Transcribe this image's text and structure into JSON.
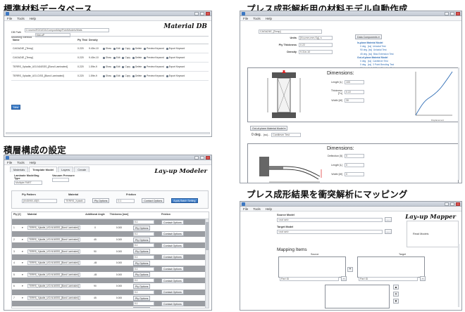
{
  "captions": {
    "db": "標準材料データベース",
    "model": "プレス成形解析用の材料モデル自動作成",
    "layup": "積層構成の設定",
    "mapping": "プレス成形結果を衝突解析にマッピング"
  },
  "material_db": {
    "menu": [
      "File",
      "Tools",
      "Help"
    ],
    "db_path_label": "DB Path",
    "db_path_value": "C:/users/ROOATA/ComposMap/PointModels/Mats",
    "method_label": "Modeling Method",
    "method_value": "Mat-aP",
    "logo": "Material DB",
    "columns": [
      "Name",
      "Ply Thickness",
      "Density"
    ],
    "rows": [
      {
        "name": "CAGAZ4E_[Temp]",
        "thickness": "0.220",
        "density": "9.40e-10"
      },
      {
        "name": "CAGAZ4E_[Temp]",
        "thickness": "0.220",
        "density": "9.40e-10"
      },
      {
        "name": "TERRS_Xpladte_UGI-N16SSS_[Bond Laminated]",
        "thickness": "0.220",
        "density": "1.59e-9"
      },
      {
        "name": "TERRS_Xpladte_UGI-CISS_[Bond Laminated]",
        "thickness": "0.220",
        "density": "1.59e-9"
      }
    ],
    "actions": [
      "Show",
      "Edit",
      "Copy",
      "Delete",
      "Preview Keyword",
      "Export Keyword"
    ],
    "new_button": "New"
  },
  "material_model": {
    "combo": "CAGAZ4E_[Temp]",
    "fields": [
      {
        "label": "Units",
        "value": "[N,s,mm,mm,Sg], s"
      },
      {
        "label": "Ply Thickness",
        "value": "0.22"
      },
      {
        "label": "Density",
        "value": "9.31e-10"
      }
    ],
    "data_components_button": "Data Components ▾",
    "tests": [
      {
        "header": true,
        "text": "In-plane Material Model"
      },
      {
        "text": "0 deg.  [ss]  Uniaxial Test"
      },
      {
        "text": "90 deg. [ss]  Uniaxial Test"
      },
      {
        "text": "45 deg. [ss]  Bias Extension Test"
      },
      {
        "header": true,
        "text": "Out-of-plane Material Model"
      },
      {
        "text": "0 deg.  [ss]  Cantilever Test"
      },
      {
        "text": "0 deg.  [ss]  3 Point Bending Test"
      },
      {
        "text": "90 deg. [ss]  3 Point Bending Test"
      }
    ],
    "dims_title": "Dimensions:",
    "dims1": [
      {
        "label": "Length [L]",
        "value": "100"
      },
      {
        "label": "Thickness [Tn]",
        "value": "0.22"
      },
      {
        "label": "Width [W]",
        "value": "30"
      }
    ],
    "dims2": [
      {
        "label": "Deflection [5]",
        "value": "0"
      },
      {
        "label": "Length [L]",
        "value": "0"
      },
      {
        "label": "Width [W]",
        "value": "0"
      }
    ],
    "out_of_plane_select": "Out-of-plane Material Model ▾",
    "deg_label": "0 deg.",
    "deg_unit": "[ss] -",
    "deg_combo": "Cantilever Test",
    "curve_xlabel": "Displacement"
  },
  "layup": {
    "menu": [
      "File",
      "Tools",
      "Help"
    ],
    "tabs": [
      "Materials",
      "Template Model",
      "Layers",
      "Create"
    ],
    "logo": "Lay-up Modeler",
    "lam_method_label": "Laminate Modelling Type",
    "lam_method_value": "Multiple PART",
    "vacuum_label": "Vacuum Pressure",
    "ply_pattern_label": "Ply Pattern",
    "ply_pattern_value": "[0/45/90/-45]S",
    "material_label": "Material",
    "material_value": "TERRS_Xpladt...",
    "ply_options_btn": "Ply Options",
    "friction_label": "Friction",
    "friction_value": "0.1",
    "contact_options_btn": "Contact Options",
    "apply_btn": "Apply Batch Setting",
    "grid_headers": [
      "Ply [#]",
      "Material",
      "Additional Angle",
      "Thickness [mm]",
      "",
      "Friction"
    ],
    "grid_rows": [
      {
        "type": "b",
        "friction": "0.1",
        "contact": "Contact Options"
      },
      {
        "type": "a",
        "ply": "1",
        "material": "TERRS_Xpladte_UGI-N16SSS_[Bond Laminated]",
        "angle": "0",
        "thickness": "0.000",
        "opt": "Ply Options"
      },
      {
        "type": "b",
        "friction": "0.1",
        "contact": "Contact Options"
      },
      {
        "type": "a",
        "ply": "2",
        "material": "TERRS_Xpladte_UGI-N16SSS_[Bond Laminated]",
        "angle": "45",
        "thickness": "0.000",
        "opt": "Ply Options"
      },
      {
        "type": "b",
        "friction": "0.1",
        "contact": "Contact Options"
      },
      {
        "type": "a",
        "ply": "3",
        "material": "TERRS_Xpladte_UGI-N16SSS_[Bond Laminated]",
        "angle": "90",
        "thickness": "0.000",
        "opt": "Ply Options"
      },
      {
        "type": "b",
        "friction": "0.1",
        "contact": "Contact Options"
      },
      {
        "type": "a",
        "ply": "4",
        "material": "TERRS_Xpladte_UGI-N16SSS_[Bond Laminated]",
        "angle": "-45",
        "thickness": "0.000",
        "opt": "Ply Options"
      },
      {
        "type": "b",
        "friction": "0.1",
        "contact": "Contact Options"
      },
      {
        "type": "a",
        "ply": "5",
        "material": "TERRS_Xpladte_UGI-N16SSS_[Bond Laminated]",
        "angle": "-45",
        "thickness": "0.000",
        "opt": "Ply Options"
      },
      {
        "type": "b",
        "friction": "0.1",
        "contact": "Contact Options"
      },
      {
        "type": "a",
        "ply": "6",
        "material": "TERRS_Xpladte_UGI-N16SSS_[Bond Laminated]",
        "angle": "90",
        "thickness": "0.000",
        "opt": "Ply Options"
      },
      {
        "type": "b",
        "friction": "0.1",
        "contact": "Contact Options"
      },
      {
        "type": "a",
        "ply": "7",
        "material": "TERRS_Xpladte_UGI-N16SSS_[Bond Laminated]",
        "angle": "45",
        "thickness": "0.000",
        "opt": "Ply Options"
      },
      {
        "type": "b",
        "friction": "0.1",
        "contact": "Contact Options"
      },
      {
        "type": "a",
        "ply": "8",
        "material": "TERRS_Xpladte_UGI-N16SSS_[Bond Laminated]",
        "angle": "0",
        "thickness": "0.000",
        "opt": "Ply Options"
      }
    ]
  },
  "mapper": {
    "menu": [
      "File",
      "Tools",
      "Help"
    ],
    "logo": "Lay-up Mapper",
    "source_label": "Source Model",
    "source_value": "<not set>",
    "target_label": "Target Model",
    "target_value": "<not set>",
    "read_models": "Read Models",
    "mapping_items": "Mapping Items",
    "source_col": "Source",
    "target_col": "Target",
    "part_placeholder": "Part ID"
  }
}
